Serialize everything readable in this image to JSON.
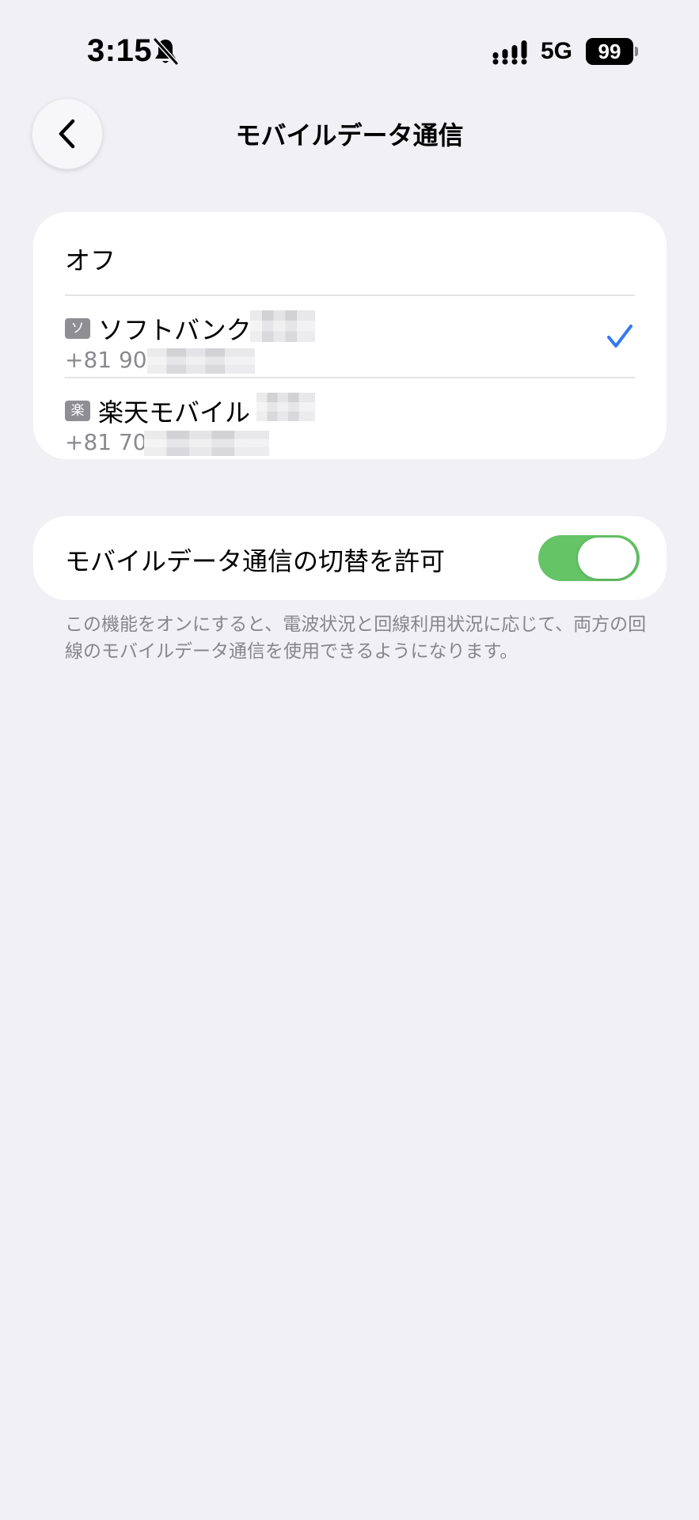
{
  "status_bar": {
    "time": "3:15",
    "network": "5G",
    "battery": "99"
  },
  "nav": {
    "title": "モバイルデータ通信"
  },
  "sim_list": {
    "off_label": "オフ",
    "lines": [
      {
        "badge": "ソ",
        "carrier": "ソフトバンク",
        "number_prefix": "+81 90",
        "selected": true
      },
      {
        "badge": "楽",
        "carrier": "楽天モバイル",
        "number_prefix": "+81 70",
        "selected": false
      }
    ]
  },
  "switching": {
    "label": "モバイルデータ通信の切替を許可",
    "enabled": true,
    "footnote": "この機能をオンにすると、電波状況と回線利用状況に応じて、両方の回線のモバイルデータ通信を使用できるようになります。"
  },
  "colors": {
    "background": "#f1f0f5",
    "toggle_on": "#65c466",
    "checkmark": "#3478f6",
    "secondary_text": "#86868b"
  }
}
